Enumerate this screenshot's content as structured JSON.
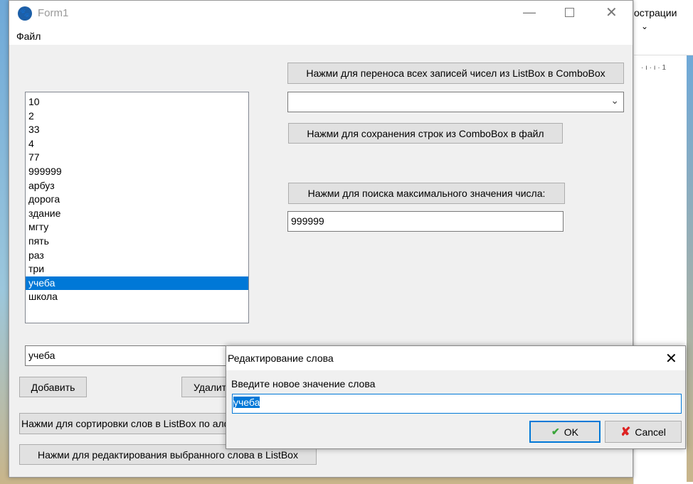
{
  "background_app": {
    "ribbon_text": "острации",
    "ruler_text": "· ı · ı · 1"
  },
  "window": {
    "title": "Form1",
    "menu": [
      "Файл"
    ]
  },
  "main": {
    "transfer_button": "Нажми для переноса всех записей чисел из ListBox в ComboBox",
    "combobox_value": "",
    "save_button": "Нажми для сохранения строк из ComboBox в файл",
    "max_button": "Нажми для поиска максимального значения числа:",
    "max_value": "999999",
    "listbox_items": [
      "10",
      "2",
      "33",
      "4",
      "77",
      "999999",
      "арбуз",
      "дорога",
      "здание",
      "мгту",
      "пять",
      "раз",
      "три",
      "учеба",
      "школа"
    ],
    "selected_index": 13,
    "word_input": "учеба",
    "add_button": "Добавить",
    "delete_button": "Удалить",
    "sort_button": "Нажми для сортировки слов в ListBox по алфавиту",
    "edit_button": "Нажми для редактирования выбранного слова в ListBox"
  },
  "dialog": {
    "title": "Редактирование слова",
    "prompt": "Введите новое значение слова",
    "value": "учеба",
    "ok": "OK",
    "cancel": "Cancel"
  },
  "colors": {
    "accent": "#0078d7"
  }
}
